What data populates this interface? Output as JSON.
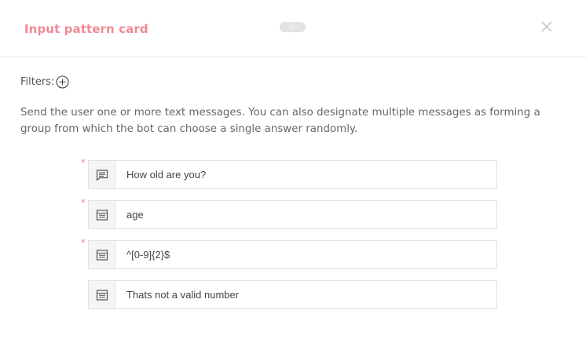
{
  "header": {
    "title": "Input pattern card"
  },
  "filters": {
    "label": "Filters:"
  },
  "description": "Send the user one or more text messages. You can also designate multiple messages as forming a group from which the bot can choose a single answer randomly.",
  "fields": [
    {
      "value": "How old are you?",
      "icon": "message-icon",
      "required": true
    },
    {
      "value": "age",
      "icon": "list-icon",
      "required": true
    },
    {
      "value": "^[0-9]{2}$",
      "icon": "list-icon",
      "required": true
    },
    {
      "value": "Thats not a valid number",
      "icon": "list-icon",
      "required": false
    }
  ],
  "required_marker": "*",
  "colors": {
    "accent": "#ee8a96",
    "border": "#e2e2e2",
    "addon_bg": "#f5f5f5"
  }
}
